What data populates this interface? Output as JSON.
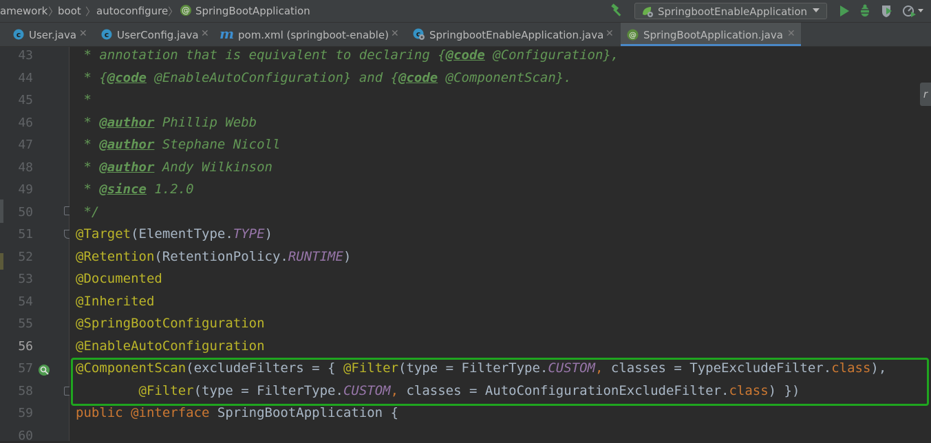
{
  "breadcrumb": {
    "items": [
      "amework",
      "boot",
      "autoconfigure",
      "SpringBootApplication"
    ]
  },
  "toolbar": {
    "run_config_label": "SpringbootEnableApplication"
  },
  "tabs": [
    {
      "label": "User.java",
      "icon": "class-icon",
      "active": false
    },
    {
      "label": "UserConfig.java",
      "icon": "class-icon",
      "active": false
    },
    {
      "label": "pom.xml (springboot-enable)",
      "icon": "maven-icon",
      "active": false
    },
    {
      "label": "SpringbootEnableApplication.java",
      "icon": "spring-boot-class-icon",
      "active": false
    },
    {
      "label": "SpringBootApplication.java",
      "icon": "annotation-icon",
      "active": true
    }
  ],
  "editor": {
    "line_numbers": [
      "43",
      "44",
      "45",
      "46",
      "47",
      "48",
      "49",
      "50",
      "51",
      "52",
      "53",
      "54",
      "55",
      "56",
      "57",
      "58",
      "59",
      "60"
    ],
    "current_line": "56",
    "code": {
      "l43": {
        "a": " * annotation that is equivalent to declaring {",
        "b": "@code",
        "c": " @Configuration},"
      },
      "l44": {
        "a": " * {",
        "b": "@code",
        "c": " @EnableAutoConfiguration} and {",
        "d": "@code",
        "e": " @ComponentScan}."
      },
      "l45": {
        "a": " *"
      },
      "l46": {
        "a": " * ",
        "b": "@author",
        "c": " Phillip Webb"
      },
      "l47": {
        "a": " * ",
        "b": "@author",
        "c": " Stephane Nicoll"
      },
      "l48": {
        "a": " * ",
        "b": "@author",
        "c": " Andy Wilkinson"
      },
      "l49": {
        "a": " * ",
        "b": "@since",
        "c": " 1.2.0"
      },
      "l50": {
        "a": " */"
      },
      "l51": {
        "a": "@Target",
        "b": "(ElementType.",
        "c": "TYPE",
        "d": ")"
      },
      "l52": {
        "a": "@Retention",
        "b": "(RetentionPolicy.",
        "c": "RUNTIME",
        "d": ")"
      },
      "l53": {
        "a": "@Documented"
      },
      "l54": {
        "a": "@Inherited"
      },
      "l55": {
        "a": "@SpringBootConfiguration"
      },
      "l56": {
        "a": "@EnableAutoConfiguration"
      },
      "l57": {
        "a": "@ComponentScan",
        "b": "(excludeFilters = { ",
        "c": "@Filter",
        "d": "(type = FilterType.",
        "e": "CUSTOM",
        "f": ", ",
        "g": "classes = TypeExcludeFilter.",
        "h": "class",
        "i": "),"
      },
      "l58": {
        "a": "        ",
        "b": "@Filter",
        "c": "(type = FilterType.",
        "d": "CUSTOM",
        "e": ", ",
        "f": "classes = AutoConfigurationExcludeFilter.",
        "g": "class",
        "h": ") })"
      },
      "l59": {
        "a": "public ",
        "b": "@interface",
        "c": " SpringBootApplication {"
      }
    }
  },
  "colors": {
    "background": "#2b2b2b",
    "doc_comment": "#629755",
    "annotation": "#bbb529",
    "keyword": "#cc7832",
    "constant": "#9876aa",
    "highlight_box": "#1fa51f"
  },
  "right_edge_label": "r"
}
